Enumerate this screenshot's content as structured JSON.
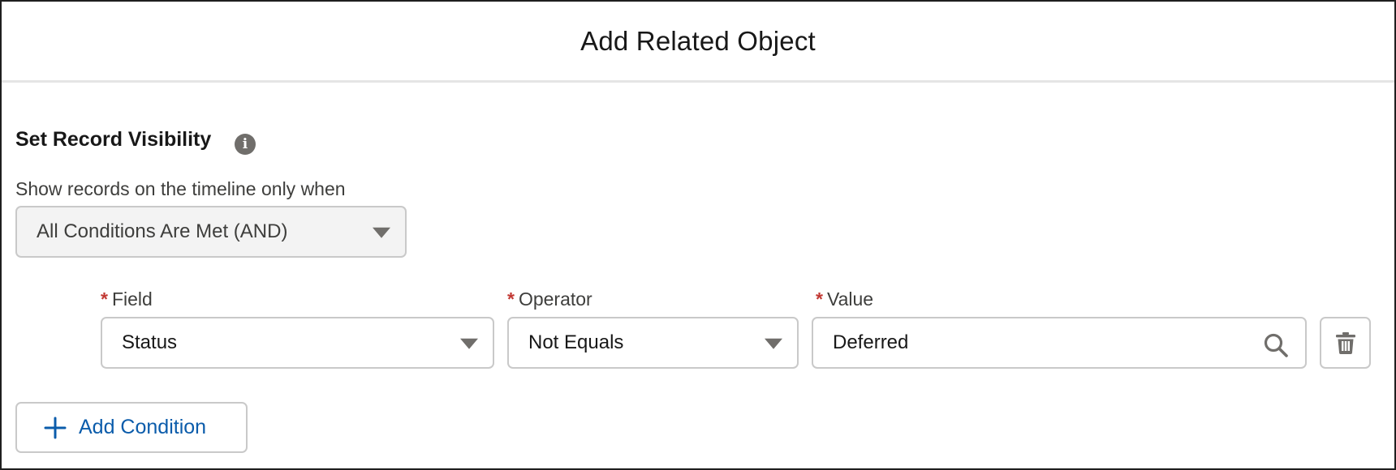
{
  "modal": {
    "title": "Add Related Object"
  },
  "visibility": {
    "title": "Set Record Visibility",
    "info_icon_glyph": "i",
    "logic_label": "Show records on the timeline only when",
    "logic_value": "All Conditions Are Met (AND)"
  },
  "condition": {
    "required_marker": "*",
    "field_label": "Field",
    "field_value": "Status",
    "operator_label": "Operator",
    "operator_value": "Not Equals",
    "value_label": "Value",
    "value_value": "Deferred"
  },
  "actions": {
    "add_condition_label": "Add Condition"
  },
  "icons": {
    "info": "info-icon",
    "caret": "chevron-down-icon",
    "search": "search-icon",
    "delete": "trash-icon",
    "add": "plus-icon"
  },
  "colors": {
    "link_blue": "#0b5cab",
    "required_red": "#c23934",
    "icon_gray": "#706e6b",
    "border_gray": "#c9c9c9"
  }
}
